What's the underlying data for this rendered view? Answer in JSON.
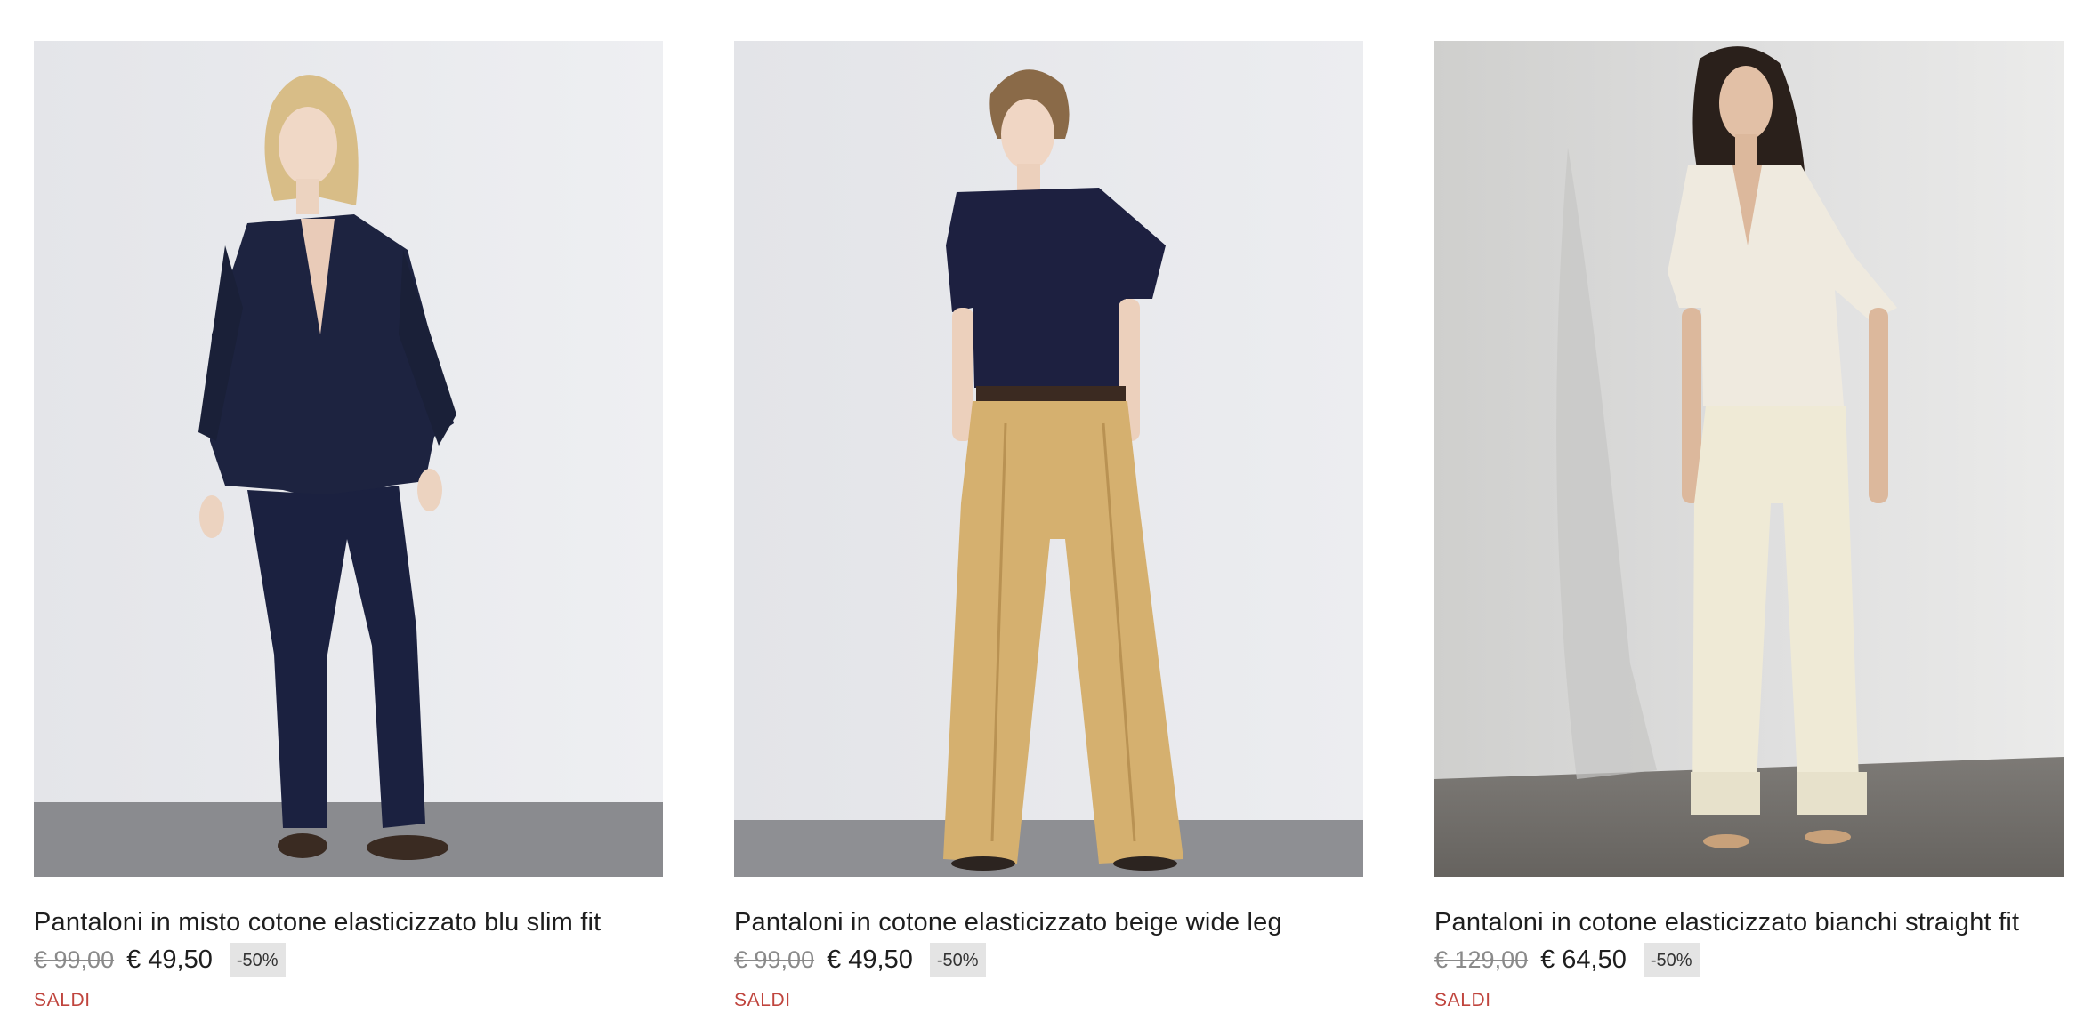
{
  "products": [
    {
      "title": "Pantaloni in misto cotone elasticizzato blu slim fit",
      "old_price": "€ 99,00",
      "new_price": "€ 49,50",
      "discount": "-50%",
      "tag": "SALDI",
      "image": "model-navy-suit-photo",
      "colors": {
        "backdrop": "#e9eaed",
        "floor": "#8a8b8f",
        "garment": "#1d2340"
      }
    },
    {
      "title": "Pantaloni in cotone elasticizzato beige wide leg",
      "old_price": "€ 99,00",
      "new_price": "€ 49,50",
      "discount": "-50%",
      "tag": "SALDI",
      "image": "model-beige-wide-leg-photo",
      "colors": {
        "backdrop": "#e7e8eb",
        "floor": "#8e8f93",
        "garment": "#d5b06f"
      }
    },
    {
      "title": "Pantaloni in cotone elasticizzato bianchi straight fit",
      "old_price": "€ 129,00",
      "new_price": "€ 64,50",
      "discount": "-50%",
      "tag": "SALDI",
      "image": "model-ivory-straight-fit-photo",
      "colors": {
        "backdrop": "#dcdcda",
        "floor": "#6f6c68",
        "garment": "#efead6"
      }
    }
  ]
}
